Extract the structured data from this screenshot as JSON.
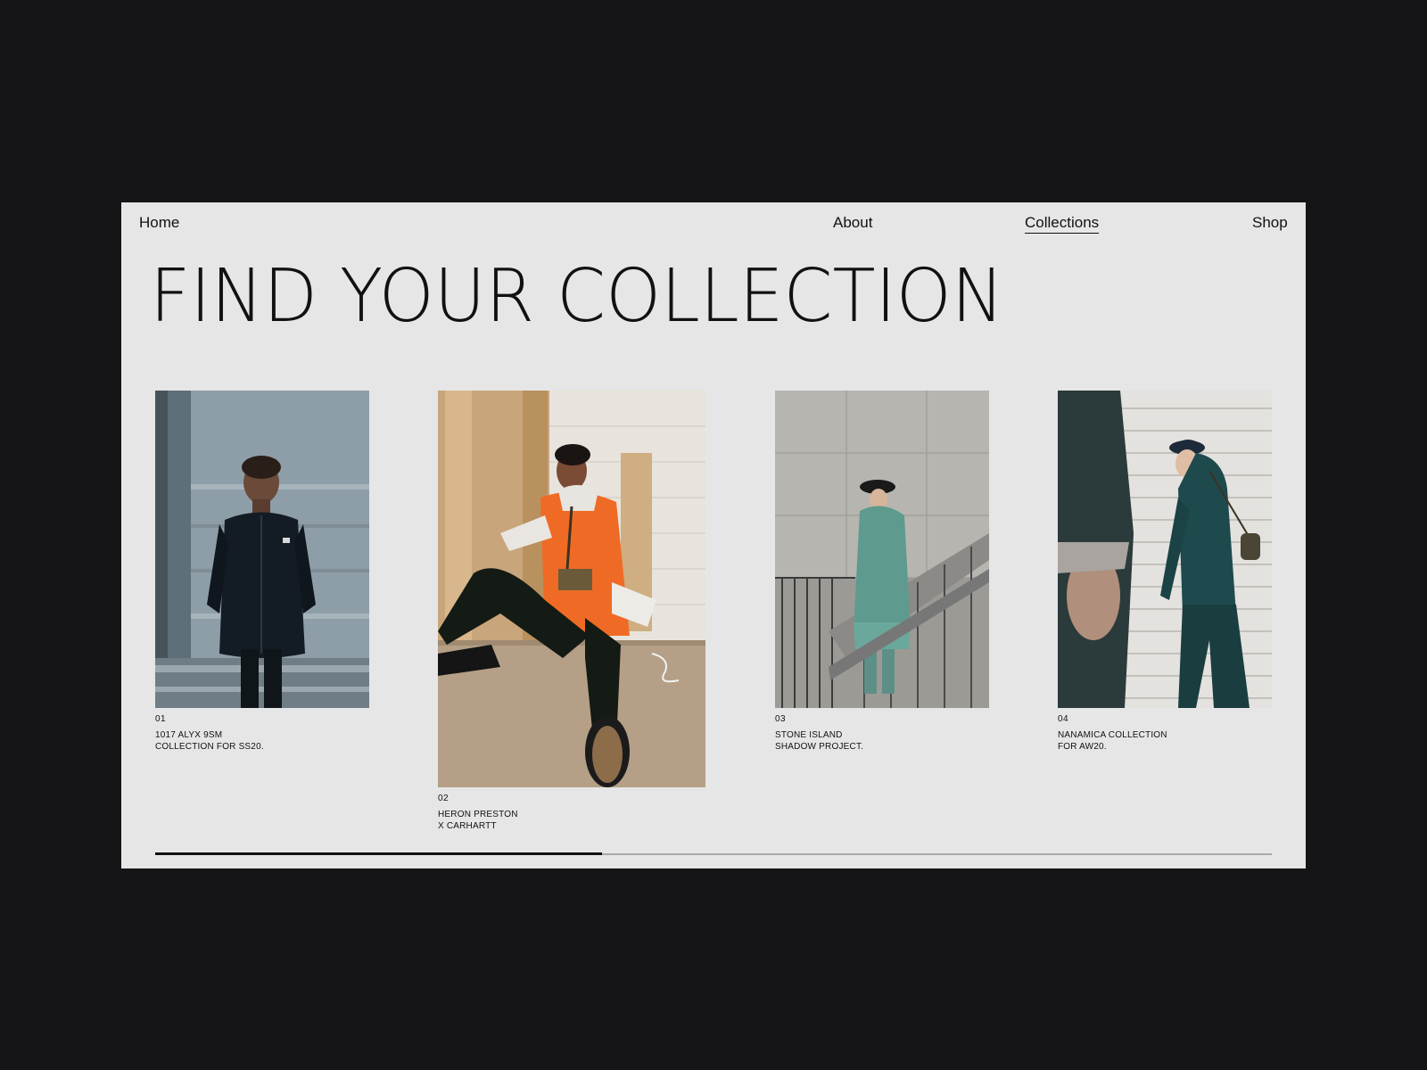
{
  "nav": {
    "home": "Home",
    "about": "About",
    "collections": "Collections",
    "shop": "Shop",
    "active": "Collections"
  },
  "hero": {
    "title": "FIND YOUR COLLECTION"
  },
  "collections": [
    {
      "number": "01",
      "line1": "1017 ALYX 9SM",
      "line2": "COLLECTION FOR SS20."
    },
    {
      "number": "02",
      "line1": "HERON PRESTON",
      "line2": "X CARHARTT"
    },
    {
      "number": "03",
      "line1": "STONE ISLAND",
      "line2": "SHADOW PROJECT."
    },
    {
      "number": "04",
      "line1": "NANAMICA COLLECTION",
      "line2": "FOR AW20."
    }
  ],
  "slider": {
    "progress": 0.4
  },
  "colors": {
    "background": "#151517",
    "panel": "#e6e6e6",
    "text": "#111111",
    "track": "#a9a9a9"
  }
}
